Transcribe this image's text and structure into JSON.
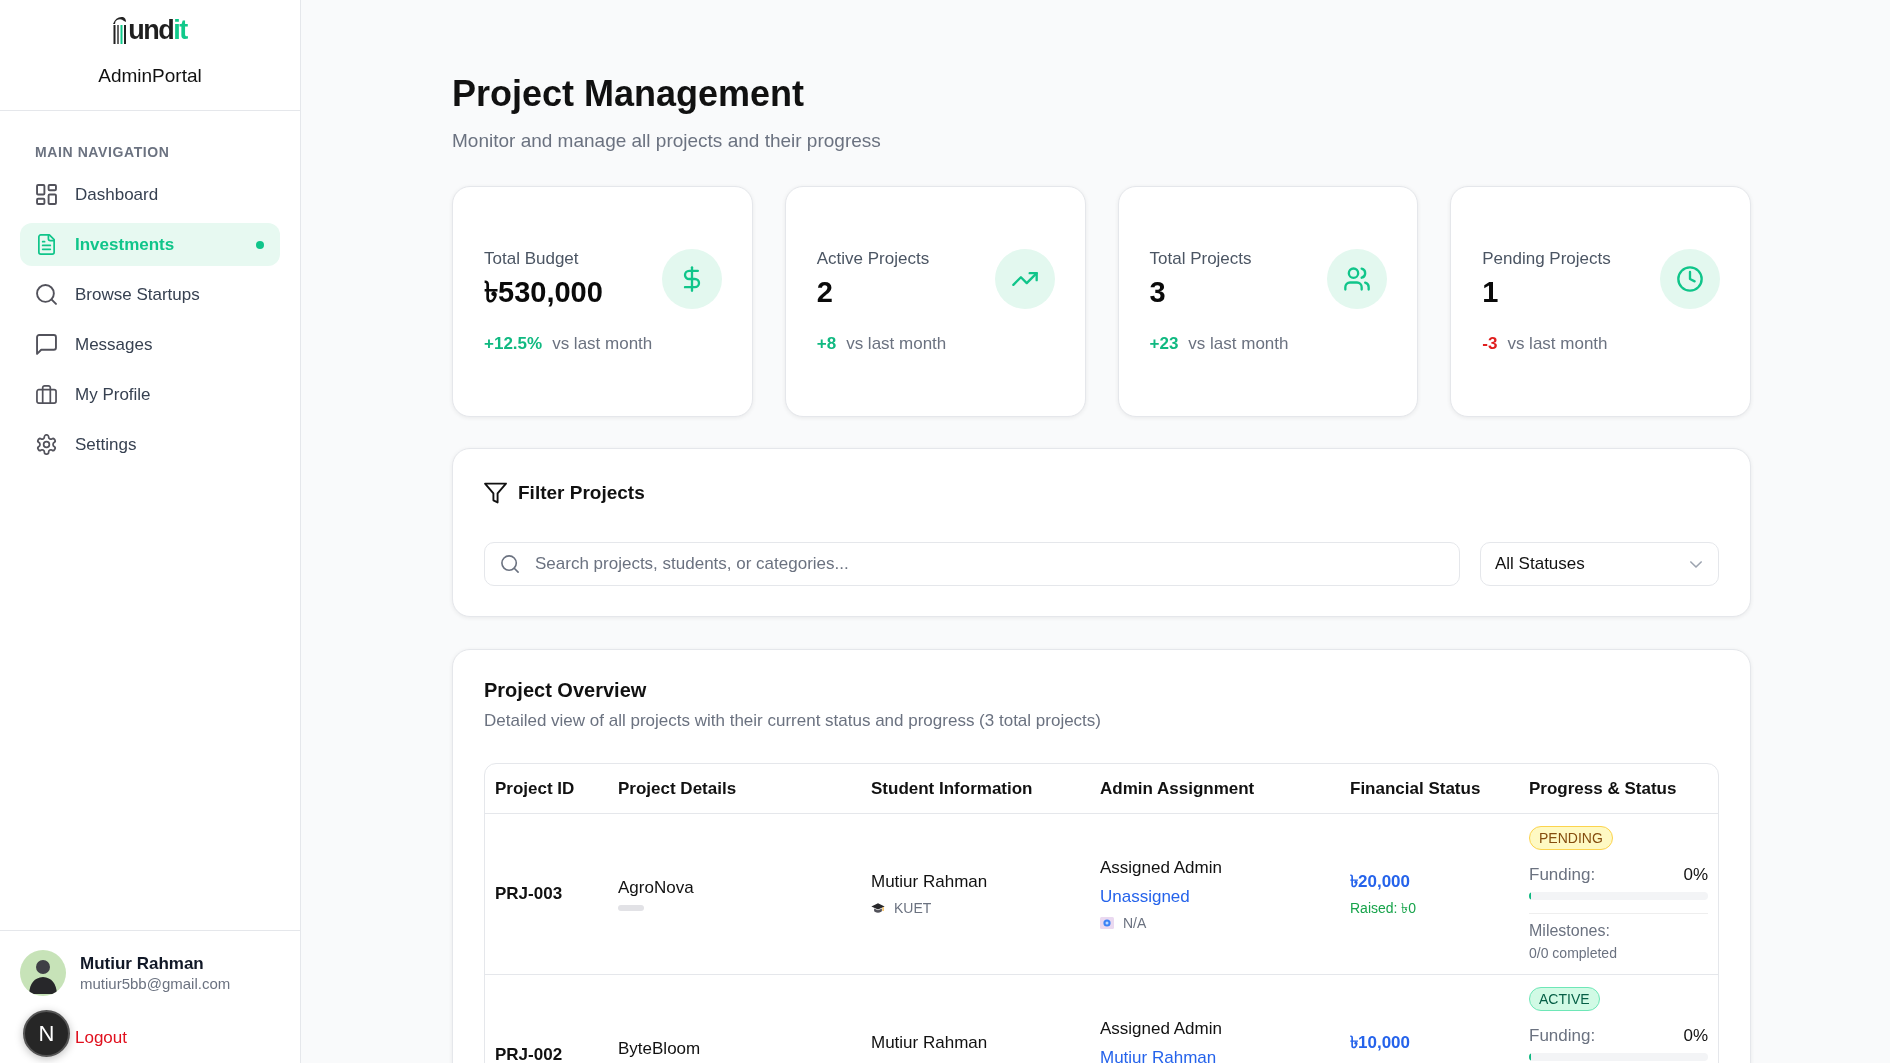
{
  "sidebar": {
    "logo": {
      "text": "und",
      "accent": "it"
    },
    "portal_name": "AdminPortal",
    "section_label": "MAIN NAVIGATION",
    "nav_items": [
      {
        "label": "Dashboard",
        "selected": false
      },
      {
        "label": "Investments",
        "selected": true
      },
      {
        "label": "Browse Startups",
        "selected": false
      },
      {
        "label": "Messages",
        "selected": false
      },
      {
        "label": "My Profile",
        "selected": false
      },
      {
        "label": "Settings",
        "selected": false
      }
    ],
    "user": {
      "name": "Mutiur Rahman",
      "email": "mutiur5bb@gmail.com"
    },
    "logout": "Logout"
  },
  "dev_badge": {
    "label": "N"
  },
  "header": {
    "title": "Project Management",
    "subtitle": "Monitor and manage all projects and their progress"
  },
  "stats": [
    {
      "label": "Total Budget",
      "value": "৳530,000",
      "change": "+12.5%",
      "positive": true,
      "note": "vs last month"
    },
    {
      "label": "Active Projects",
      "value": "2",
      "change": "+8",
      "positive": true,
      "note": "vs last month"
    },
    {
      "label": "Total Projects",
      "value": "3",
      "change": "+23",
      "positive": true,
      "note": "vs last month"
    },
    {
      "label": "Pending Projects",
      "value": "1",
      "change": "-3",
      "positive": false,
      "note": "vs last month"
    }
  ],
  "filter": {
    "title": "Filter Projects",
    "search": {
      "placeholder": "Search projects, students, or categories..."
    },
    "status_select": {
      "value": "All Statuses"
    }
  },
  "overview": {
    "title": "Project Overview",
    "description": "Detailed view of all projects with their current status and progress (3 total projects)",
    "table": {
      "columns": [
        "Project ID",
        "Project Details",
        "Student Information",
        "Admin Assignment",
        "Financial Status",
        "Progress & Status"
      ],
      "rows": [
        {
          "project_id": "PRJ-003",
          "project_name": "AgroNova",
          "tag": true,
          "student": {
            "name": "Mutiur Rahman",
            "university": "KUET"
          },
          "admin": {
            "label": "Assigned Admin",
            "name": "Unassigned",
            "contact": "N/A"
          },
          "finance": {
            "budget": "৳20,000",
            "raised": "Raised: ৳0"
          },
          "progress": {
            "status": {
              "label": "PENDING",
              "kind": "pending"
            },
            "funding_label": "Funding:",
            "funding_value": "0%",
            "level": 0,
            "milestones_label": "Milestones:",
            "milestones": "0/0 completed"
          }
        },
        {
          "project_id": "PRJ-002",
          "project_name": "ByteBloom",
          "tag": false,
          "student": {
            "name": "Mutiur Rahman"
          },
          "admin": {
            "label": "Assigned Admin",
            "name": "Mutiur Rahman"
          },
          "finance": {
            "budget": "৳10,000"
          },
          "progress": {
            "status": {
              "label": "ACTIVE",
              "kind": "active"
            },
            "funding_label": "Funding:",
            "funding_value": "0%",
            "level": 0
          }
        }
      ]
    }
  }
}
